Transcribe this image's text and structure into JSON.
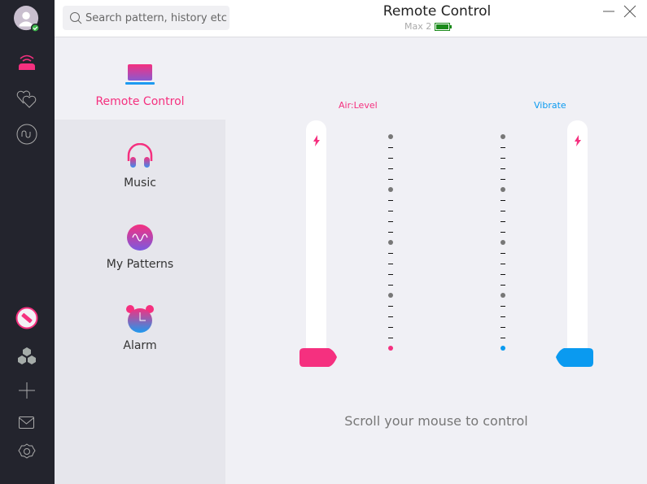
{
  "header": {
    "title": "Remote Control",
    "device": "Max 2",
    "battery_level": 1.0,
    "search_placeholder": "Search pattern, history etc."
  },
  "rail": {
    "icons": [
      "avatar",
      "remote-icon",
      "hearts-icon",
      "pattern-icon",
      "toy-icon",
      "community-icon",
      "add-icon",
      "mail-icon",
      "settings-icon"
    ],
    "online": true
  },
  "nav": {
    "items": [
      {
        "label": "Remote Control",
        "active": true
      },
      {
        "label": "Music"
      },
      {
        "label": "My Patterns"
      },
      {
        "label": "Alarm"
      }
    ]
  },
  "controls": {
    "left": {
      "label": "Air:Level",
      "color": "#f5307f",
      "level": 0
    },
    "right": {
      "label": "Vibrate",
      "color": "#0a9af0",
      "level": 0
    }
  },
  "hint": "Scroll your mouse to control",
  "colors": {
    "accent": "#f5307f",
    "blue": "#0a9af0",
    "rail": "#23242d"
  }
}
